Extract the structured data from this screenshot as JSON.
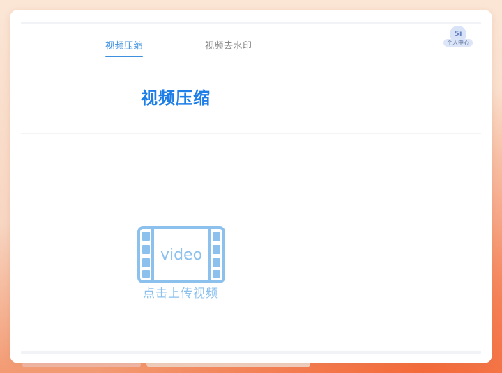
{
  "tabs": [
    {
      "label": "视频压缩",
      "active": true
    },
    {
      "label": "视频去水印",
      "active": false
    }
  ],
  "user": {
    "badge": "5i",
    "label": "个人中心"
  },
  "title": "视频压缩",
  "upload": {
    "icon_text": "video",
    "label": "点击上传视频",
    "icon": "video-film-icon"
  },
  "colors": {
    "accent": "#3d8fe0",
    "title": "#1e7ee8",
    "upload": "#8cc1ee",
    "inactive_tab": "#8a8a8a"
  }
}
